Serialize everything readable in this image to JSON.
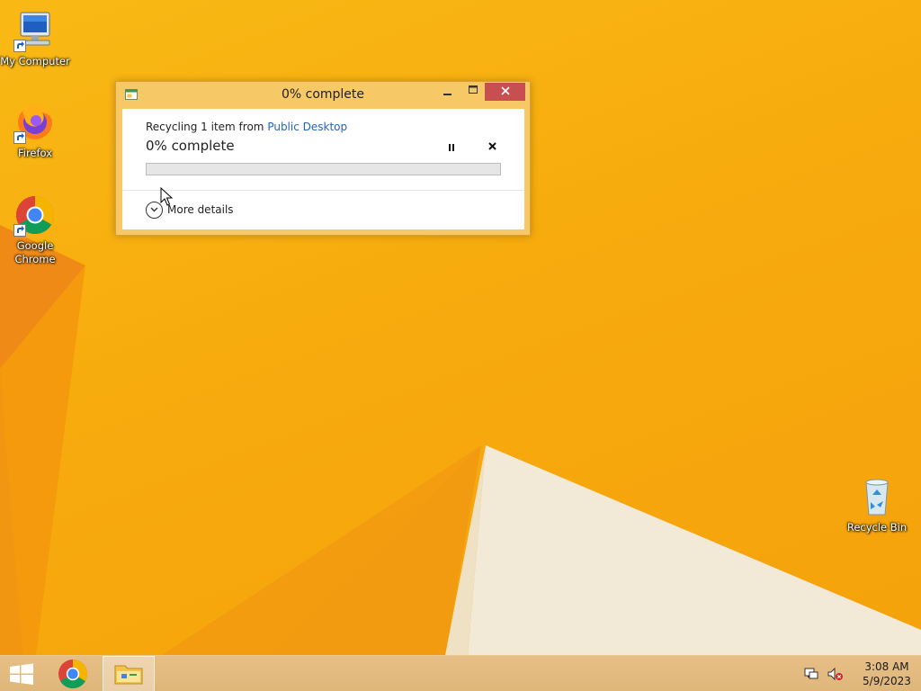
{
  "desktop": {
    "icons": [
      {
        "label": "My Computer",
        "icon": "computer-icon"
      },
      {
        "label": "Firefox",
        "icon": "firefox-icon"
      },
      {
        "label": "Google Chrome",
        "icon": "chrome-icon"
      },
      {
        "label": "Recycle Bin",
        "icon": "recycle-bin-icon"
      }
    ],
    "wallpaper_colors": [
      "#f7ab0d",
      "#f08a16",
      "#f2e9d7"
    ]
  },
  "dialog": {
    "title": "0% complete",
    "operation_prefix": "Recycling 1 item from ",
    "operation_location": "Public Desktop",
    "percent_text": "0% complete",
    "progress": 0,
    "more_details_label": "More details",
    "title_buttons": [
      "minimize",
      "maximize",
      "close"
    ],
    "accent_color": "#f6c866",
    "close_color": "#c74f4f",
    "link_color": "#2266b6"
  },
  "taskbar": {
    "items": [
      {
        "name": "start-button",
        "icon": "windows-logo-icon"
      },
      {
        "name": "chrome",
        "icon": "chrome-icon"
      },
      {
        "name": "file-explorer",
        "icon": "folder-icon",
        "active": true
      }
    ],
    "tray": {
      "icons": [
        "network-icon",
        "volume-muted-icon"
      ],
      "time": "3:08 AM",
      "date": "5/9/2023"
    }
  }
}
